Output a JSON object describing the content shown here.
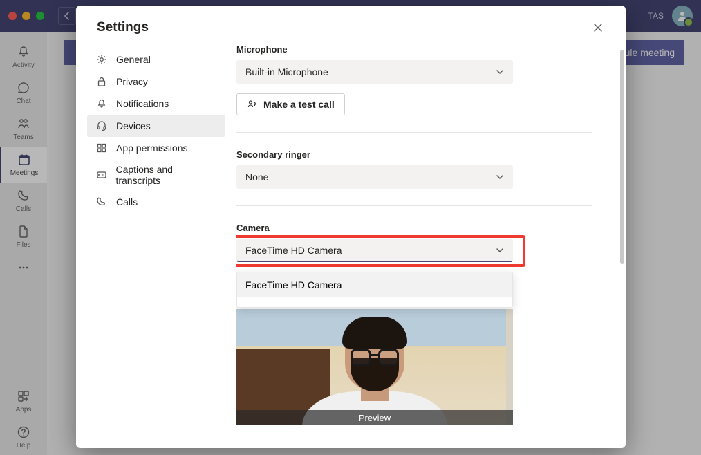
{
  "titlebar": {
    "user_initials": "TAS"
  },
  "rail": {
    "items": [
      {
        "label": "Activity"
      },
      {
        "label": "Chat"
      },
      {
        "label": "Teams"
      },
      {
        "label": "Meetings"
      },
      {
        "label": "Calls"
      },
      {
        "label": "Files"
      }
    ],
    "apps_label": "Apps",
    "help_label": "Help"
  },
  "background": {
    "schedule_button": "Schedule meeting"
  },
  "settings": {
    "title": "Settings",
    "nav": [
      {
        "label": "General"
      },
      {
        "label": "Privacy"
      },
      {
        "label": "Notifications"
      },
      {
        "label": "Devices"
      },
      {
        "label": "App permissions"
      },
      {
        "label": "Captions and transcripts"
      },
      {
        "label": "Calls"
      }
    ],
    "microphone": {
      "label": "Microphone",
      "selected": "Built-in Microphone",
      "test_call_label": "Make a test call"
    },
    "secondary_ringer": {
      "label": "Secondary ringer",
      "selected": "None"
    },
    "camera": {
      "label": "Camera",
      "selected": "FaceTime HD Camera",
      "options": [
        "FaceTime HD Camera"
      ],
      "preview_label": "Preview"
    }
  }
}
